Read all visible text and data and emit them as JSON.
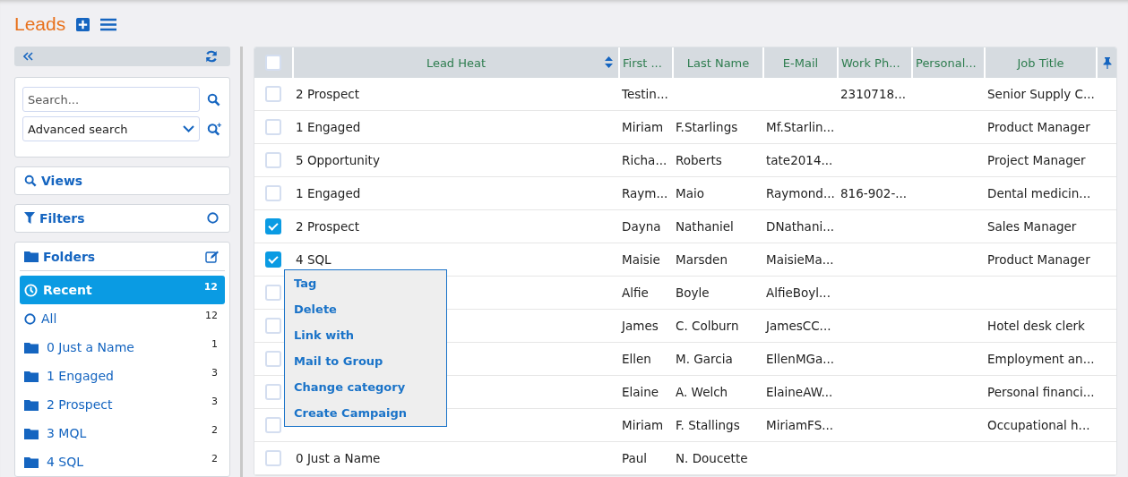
{
  "page": {
    "title": "Leads"
  },
  "sidebar": {
    "search": {
      "placeholder": "Search..."
    },
    "advanced_search": {
      "value": "Advanced search"
    },
    "views": {
      "label": "Views"
    },
    "filters": {
      "label": "Filters"
    },
    "folders": {
      "label": "Folders",
      "items": [
        {
          "label": "Recent",
          "count": "12",
          "kind": "recent",
          "selected": true
        },
        {
          "label": "All",
          "count": "12",
          "kind": "all",
          "selected": false
        },
        {
          "label": "0 Just a Name",
          "count": "1",
          "kind": "folder",
          "selected": false
        },
        {
          "label": "1 Engaged",
          "count": "3",
          "kind": "folder",
          "selected": false
        },
        {
          "label": "2 Prospect",
          "count": "3",
          "kind": "folder",
          "selected": false
        },
        {
          "label": "3 MQL",
          "count": "2",
          "kind": "folder",
          "selected": false
        },
        {
          "label": "4 SQL",
          "count": "2",
          "kind": "folder",
          "selected": false
        }
      ]
    }
  },
  "table": {
    "header_checked": false,
    "columns": [
      "Lead Heat",
      "First ...",
      "Last Name",
      "E-Mail",
      "Work Ph...",
      "Personal...",
      "Job Title"
    ],
    "rows": [
      {
        "checked": false,
        "lead_heat": "2 Prospect",
        "first_name": "Testin...",
        "work_phone": "2310718...",
        "job_title": "Senior Supply C..."
      },
      {
        "checked": false,
        "lead_heat": "1 Engaged",
        "first_name": "Miriam",
        "last_name": "F.Starlings",
        "email": "Mf.Starlin...",
        "job_title": "Product Manager"
      },
      {
        "checked": false,
        "lead_heat": "5 Opportunity",
        "first_name": "Richa...",
        "last_name": "Roberts",
        "email": "tate2014...",
        "job_title": "Project Manager"
      },
      {
        "checked": false,
        "lead_heat": "1 Engaged",
        "first_name": "Raym...",
        "last_name": "Maio",
        "email": "Raymond...",
        "work_phone": "816-902-...",
        "job_title": "Dental medicin..."
      },
      {
        "checked": true,
        "lead_heat": "2 Prospect",
        "first_name": "Dayna",
        "last_name": "Nathaniel",
        "email": "DNathani...",
        "job_title": "Sales Manager"
      },
      {
        "checked": true,
        "lead_heat": "4 SQL",
        "first_name": "Maisie",
        "last_name": "Marsden",
        "email": "MaisieMa...",
        "job_title": "Product Manager"
      },
      {
        "checked": false,
        "first_name": "Alfie",
        "last_name": "Boyle",
        "email": "AlfieBoyl..."
      },
      {
        "checked": false,
        "first_name": "James",
        "last_name": "C. Colburn",
        "email": "JamesCC...",
        "job_title": "Hotel desk clerk"
      },
      {
        "checked": false,
        "first_name": "Ellen",
        "last_name": "M. Garcia",
        "email": "EllenMGa...",
        "job_title": "Employment an..."
      },
      {
        "checked": false,
        "first_name": "Elaine",
        "last_name": "A. Welch",
        "email": "ElaineAW...",
        "job_title": "Personal financi..."
      },
      {
        "checked": false,
        "first_name": "Miriam",
        "last_name": "F. Stallings",
        "email": "MiriamFS...",
        "job_title": "Occupational h..."
      },
      {
        "checked": false,
        "lead_heat": "0 Just a Name",
        "first_name": "Paul",
        "last_name": "N. Doucette"
      }
    ]
  },
  "context_menu": {
    "items": [
      "Tag",
      "Delete",
      "Link with",
      "Mail to Group",
      "Change category",
      "Create Campaign"
    ]
  }
}
